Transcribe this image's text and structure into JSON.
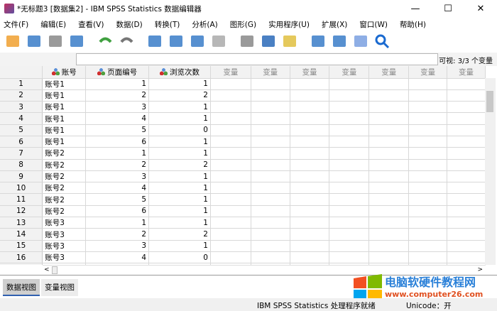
{
  "window": {
    "title": "*无标题3 [数据集2] - IBM SPSS Statistics 数据编辑器",
    "min": "—",
    "max": "☐",
    "close": "✕"
  },
  "menu": [
    "文件(F)",
    "编辑(E)",
    "查看(V)",
    "数据(D)",
    "转换(T)",
    "分析(A)",
    "图形(G)",
    "实用程序(U)",
    "扩展(X)",
    "窗口(W)",
    "帮助(H)"
  ],
  "toolbar": [
    "open-icon",
    "save-icon",
    "print-icon",
    "dialog-recall-icon",
    "undo-icon",
    "redo-icon",
    "goto-case-icon",
    "goto-variable-icon",
    "variables-icon",
    "run-icon",
    "find-icon",
    "insert-cases-icon",
    "insert-variable-icon",
    "split-file-icon",
    "value-labels-icon",
    "use-sets-icon",
    "search-icon"
  ],
  "input": {
    "value": "",
    "visible": "可视: 3/3 个变量"
  },
  "columns": [
    "账号",
    "页面编号",
    "浏览次数"
  ],
  "empty_col_label": "变量",
  "rows": [
    [
      "账号1",
      "1",
      "1"
    ],
    [
      "账号1",
      "2",
      "2"
    ],
    [
      "账号1",
      "3",
      "1"
    ],
    [
      "账号1",
      "4",
      "1"
    ],
    [
      "账号1",
      "5",
      "0"
    ],
    [
      "账号1",
      "6",
      "1"
    ],
    [
      "账号2",
      "1",
      "1"
    ],
    [
      "账号2",
      "2",
      "2"
    ],
    [
      "账号2",
      "3",
      "1"
    ],
    [
      "账号2",
      "4",
      "1"
    ],
    [
      "账号2",
      "5",
      "1"
    ],
    [
      "账号2",
      "6",
      "1"
    ],
    [
      "账号3",
      "1",
      "1"
    ],
    [
      "账号3",
      "2",
      "2"
    ],
    [
      "账号3",
      "3",
      "1"
    ],
    [
      "账号3",
      "4",
      "0"
    ]
  ],
  "tabs": [
    "数据视图",
    "变量视图"
  ],
  "status": {
    "processor": "IBM SPSS Statistics 处理程序就绪",
    "unicode": "Unicode：开"
  },
  "watermark": {
    "title": "电脑软硬件教程网",
    "url": "www.computer26.com"
  }
}
